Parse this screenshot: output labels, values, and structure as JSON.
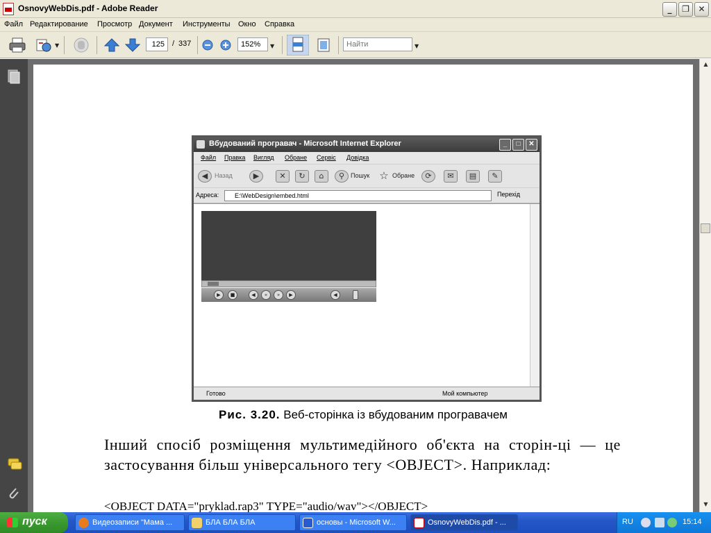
{
  "window": {
    "title": "OsnovyWebDis.pdf - Adobe Reader",
    "min_glyph": "_",
    "max_glyph": "❐",
    "close_glyph": "✕"
  },
  "menu": [
    "Файл",
    "Редактирование",
    "Просмотр",
    "Документ",
    "Инструменты",
    "Окно",
    "Справка"
  ],
  "toolbar": {
    "page_current": "125",
    "page_separator": "/",
    "page_total": "337",
    "zoom": "152%",
    "search_placeholder": "Найти",
    "icons": [
      "print-icon",
      "share-icon",
      "hand-icon",
      "arrow-up-icon",
      "arrow-down-icon",
      "zoom-out-icon",
      "zoom-in-icon",
      "fit-width-icon",
      "fit-page-icon"
    ]
  },
  "document": {
    "figure": {
      "window_title": "Вбудований програвач - Microsoft Internet Explorer",
      "menu": [
        "Файл",
        "Правка",
        "Вигляд",
        "Обране",
        "Сервіс",
        "Довідка"
      ],
      "back_label": "Назад",
      "search_label": "Пошук",
      "favorites_label": "Обране",
      "address_label": "Адреса:",
      "address_value": "E:\\WebDesign\\embed.html",
      "go_label": "Перехід",
      "status_left": "Готово",
      "status_right": "Мой компьютер"
    },
    "caption_label": "Рис. 3.20.",
    "caption_text": "Веб-сторінка із вбудованим програвачем",
    "paragraph": "Інший спосіб розміщення мультимедійного об'єкта на сторін-ці — це застосування більш універсального тегу <OBJECT>. Наприклад:",
    "code": "<OBJECT  DATA=\"pryklad.rap3\"  TYPE=\"audio/wav\"></OBJECT>"
  },
  "taskbar": {
    "start_label": "пуск",
    "tasks": [
      "Видеозаписи \"Мама ...",
      "БЛА БЛА БЛА",
      "основы - Microsoft W...",
      "OsnovyWebDis.pdf - ..."
    ],
    "language": "RU",
    "clock": "15:14"
  },
  "colors": {
    "reader_chrome": "#ece9d8",
    "doc_background": "#6d6d6d",
    "taskbar_blue": "#2557c7",
    "start_green": "#3a9a30"
  }
}
